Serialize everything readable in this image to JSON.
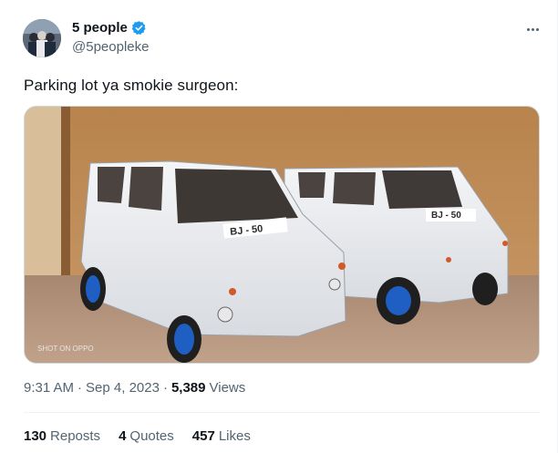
{
  "author": {
    "name": "5 people",
    "handle": "@5peopleke",
    "verified_color": "#1d9bf0"
  },
  "tweet": {
    "text": "Parking lot ya smokie surgeon:",
    "time": "9:31 AM",
    "separator": "·",
    "date": "Sep 4, 2023",
    "views_count": "5,389",
    "views_label": "Views"
  },
  "photo": {
    "plate_left": "BJ - 50",
    "plate_right": "BJ - 50",
    "watermark": "SHOT ON OPPO"
  },
  "stats": {
    "reposts_count": "130",
    "reposts_label": "Reposts",
    "quotes_count": "4",
    "quotes_label": "Quotes",
    "likes_count": "457",
    "likes_label": "Likes"
  },
  "icons": {
    "more": "more-dots-icon",
    "verified": "verified-badge-icon"
  }
}
